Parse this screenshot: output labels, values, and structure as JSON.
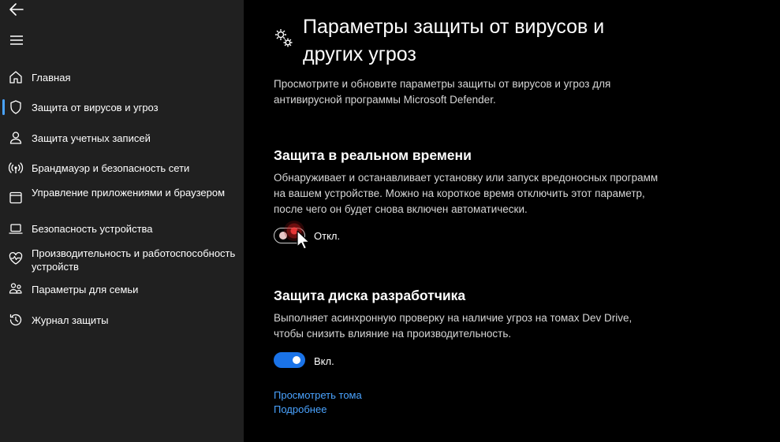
{
  "sidebar": {
    "items": [
      {
        "label": "Главная",
        "icon": "home-icon"
      },
      {
        "label": "Защита от вирусов и угроз",
        "icon": "shield-icon",
        "selected": true
      },
      {
        "label": "Защита учетных записей",
        "icon": "person-icon"
      },
      {
        "label": "Брандмауэр и безопасность сети",
        "icon": "wifi-icon"
      },
      {
        "label": "Управление приложениями и браузером",
        "icon": "app-window-icon"
      },
      {
        "label": "Безопасность устройства",
        "icon": "laptop-icon"
      },
      {
        "label": "Производительность и работоспособность устройств",
        "icon": "heart-pulse-icon"
      },
      {
        "label": "Параметры для семьи",
        "icon": "family-icon"
      },
      {
        "label": "Журнал защиты",
        "icon": "history-icon"
      }
    ]
  },
  "page": {
    "title": "Параметры защиты от вирусов и других угроз",
    "description": "Просмотрите и обновите параметры защиты от вирусов и угроз для антивирусной программы Microsoft Defender."
  },
  "realtime": {
    "title": "Защита в реальном времени",
    "description": "Обнаруживает и останавливает установку или запуск вредоносных программ на вашем устройстве. Можно на короткое время отключить этот параметр, после чего он будет снова включен автоматически.",
    "toggle_state": "off",
    "toggle_label": "Откл."
  },
  "devdrive": {
    "title": "Защита диска разработчика",
    "description": "Выполняет асинхронную проверку на наличие угроз на томах Dev Drive, чтобы снизить влияние на производительность.",
    "toggle_state": "on",
    "toggle_label": "Вкл."
  },
  "links": {
    "view_volumes": "Просмотреть тома",
    "learn_more": "Подробнее"
  },
  "colors": {
    "sidebar_bg": "#202020",
    "main_bg": "#000000",
    "accent": "#1a73e8",
    "link": "#4aa3ff"
  }
}
